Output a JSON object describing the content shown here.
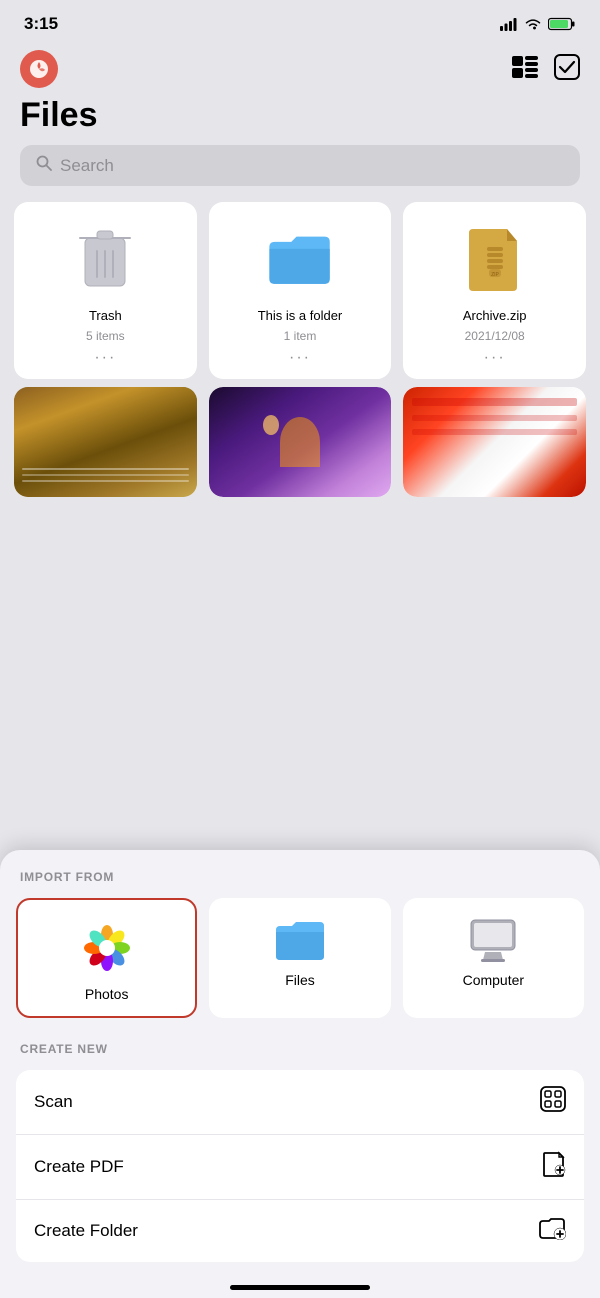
{
  "statusBar": {
    "time": "3:15",
    "signal": "●●●●",
    "wifi": "wifi",
    "battery": "battery"
  },
  "header": {
    "title": "Files",
    "listViewIcon": "list-view",
    "checkboxIcon": "checkbox"
  },
  "search": {
    "placeholder": "Search"
  },
  "fileGrid": {
    "row1": [
      {
        "name": "Trash",
        "meta": "5 items",
        "type": "trash"
      },
      {
        "name": "This is a folder",
        "meta": "1 item",
        "type": "folder"
      },
      {
        "name": "Archive.zip",
        "meta": "2021/12/08",
        "type": "zip"
      }
    ]
  },
  "bottomSheet": {
    "importLabel": "IMPORT FROM",
    "importItems": [
      {
        "id": "photos",
        "label": "Photos",
        "selected": true
      },
      {
        "id": "files",
        "label": "Files",
        "selected": false
      },
      {
        "id": "computer",
        "label": "Computer",
        "selected": false
      }
    ],
    "createLabel": "CREATE NEW",
    "createItems": [
      {
        "id": "scan",
        "label": "Scan"
      },
      {
        "id": "create-pdf",
        "label": "Create PDF"
      },
      {
        "id": "create-folder",
        "label": "Create Folder"
      }
    ]
  }
}
